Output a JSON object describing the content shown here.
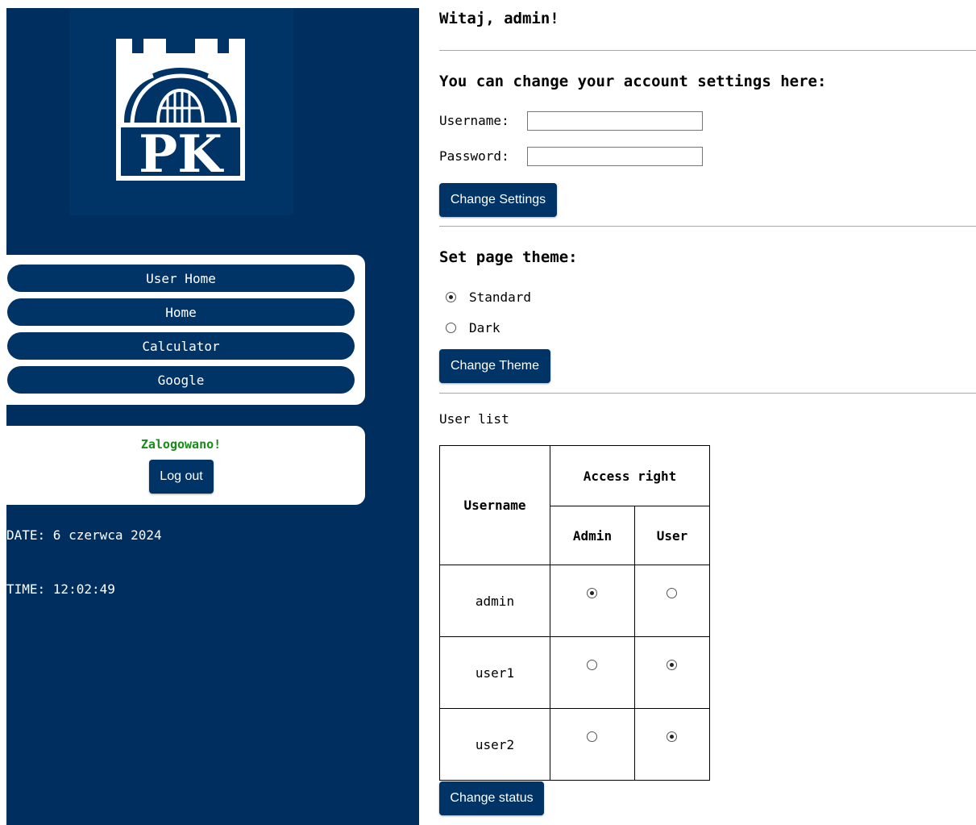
{
  "sidebar": {
    "logo": {
      "letters": "PK",
      "alt": "Politechnika Krakowska logo"
    },
    "nav": [
      {
        "label": "User Home"
      },
      {
        "label": "Home"
      },
      {
        "label": "Calculator"
      },
      {
        "label": "Google"
      }
    ],
    "status": "Zalogowano!",
    "logout_label": "Log out",
    "date_line": "DATE: 6 czerwca 2024",
    "time_line": "TIME: 12:02:49"
  },
  "main": {
    "greeting": "Witaj, admin!",
    "account_heading": "You can change your account settings here:",
    "username_label": "Username:",
    "username_value": "",
    "password_label": "Password:",
    "password_value": "",
    "change_settings_label": "Change Settings",
    "theme_heading": "Set page theme:",
    "theme_options": [
      {
        "label": "Standard",
        "checked": true
      },
      {
        "label": "Dark",
        "checked": false
      }
    ],
    "change_theme_label": "Change Theme",
    "user_list_caption": "User list",
    "table": {
      "col_username": "Username",
      "col_access": "Access right",
      "col_admin": "Admin",
      "col_user": "User",
      "rows": [
        {
          "username": "admin",
          "admin": true,
          "user": false
        },
        {
          "username": "user1",
          "admin": false,
          "user": true
        },
        {
          "username": "user2",
          "admin": false,
          "user": true
        }
      ]
    },
    "change_status_label": "Change status"
  },
  "colors": {
    "sidebar_bg": "#002e5f",
    "accent": "#003366",
    "status_green": "#1a8a1a"
  }
}
